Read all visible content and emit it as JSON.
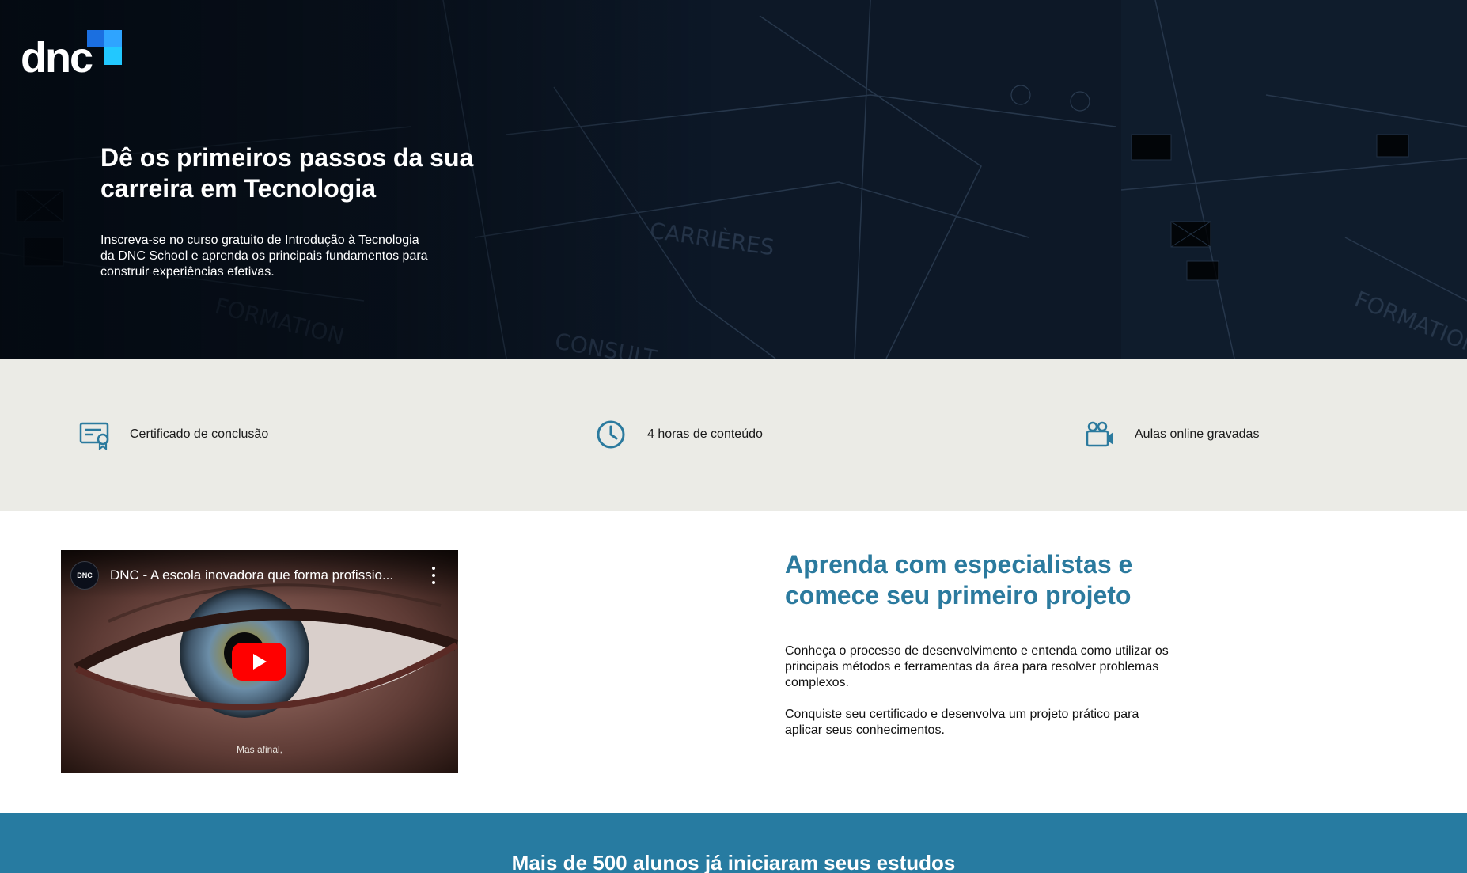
{
  "brand": {
    "logo_text": "dnc",
    "colors": {
      "primary": "#2b7a9e",
      "band": "#277ba1",
      "logo_blue": "#1b6fe0",
      "logo_cyan": "#22c8ff"
    }
  },
  "hero": {
    "title": "Dê os primeiros passos da sua carreira em Tecnologia",
    "description": "Inscreva-se no curso gratuito de Introdução à Tecnologia da DNC School e aprenda os principais fundamentos para construir experiências efetivas."
  },
  "features": [
    {
      "icon": "certificate-icon",
      "label": "Certificado de conclusão"
    },
    {
      "icon": "clock-icon",
      "label": "4 horas de conteúdo"
    },
    {
      "icon": "video-camera-icon",
      "label": "Aulas online gravadas"
    }
  ],
  "video": {
    "channel_avatar_text": "DNC",
    "title": "DNC - A escola inovadora que forma profissio...",
    "caption": "Mas afinal,"
  },
  "learn": {
    "title": "Aprenda com especialistas e comece seu primeiro projeto",
    "paragraph1": "Conheça o processo de desenvolvimento e entenda como utilizar os principais métodos e ferramentas da área para resolver problemas complexos.",
    "paragraph2": "Conquiste seu certificado e desenvolva um projeto prático para aplicar seus conhecimentos."
  },
  "band": {
    "title": "Mais de 500 alunos já iniciaram seus estudos"
  }
}
